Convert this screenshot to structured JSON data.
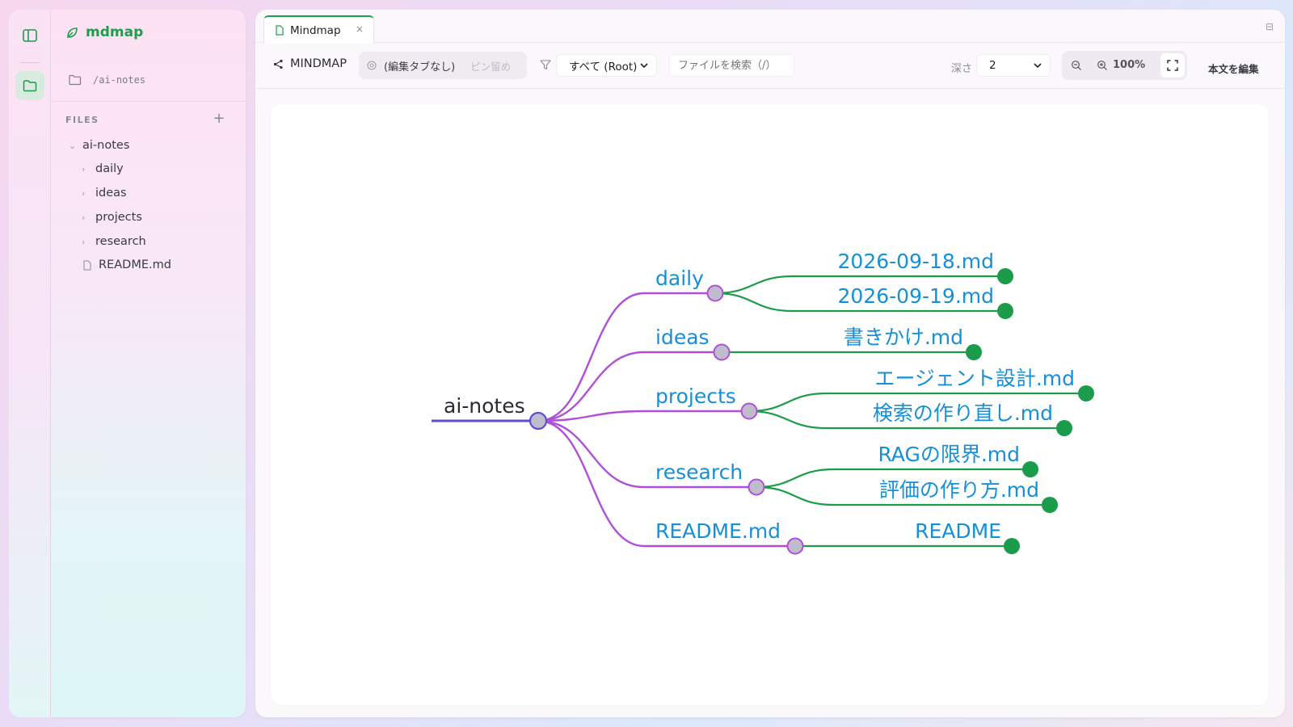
{
  "app": {
    "name": "mdmap",
    "brand_color": "#17a14a"
  },
  "rail": {
    "items": [
      {
        "icon": "sidebar-toggle-icon"
      },
      {
        "icon": "folder-icon",
        "active": true
      }
    ]
  },
  "sidebar": {
    "path": "/ai-notes",
    "files_heading": "FILES",
    "add_label": "+",
    "tree": [
      {
        "label": "ai-notes",
        "type": "folder",
        "expanded": true
      },
      {
        "label": "daily",
        "type": "folder"
      },
      {
        "label": "ideas",
        "type": "folder"
      },
      {
        "label": "projects",
        "type": "folder"
      },
      {
        "label": "research",
        "type": "folder"
      },
      {
        "label": "README.md",
        "type": "file"
      }
    ]
  },
  "tabs": [
    {
      "label": "Mindmap",
      "close": "×"
    }
  ],
  "toolbar": {
    "mindmap_label": "MINDMAP",
    "edit_tab_label": "(編集タブなし)",
    "pin_label": "ピン留め",
    "scope_value": "すべて (Root)",
    "search_placeholder": "ファイルを検索（/）",
    "depth_label": "深さ",
    "depth_value": "2",
    "zoom_percent": "100%",
    "edit_body_label": "本文を編集"
  },
  "mindmap": {
    "root": "ai-notes",
    "colors": {
      "root_line": "#5b4fd6",
      "branch": "#b04fd8",
      "leaf": "#1a9c4a",
      "label": "#1590d8",
      "node_fill": "#bfbccb"
    },
    "branches": [
      {
        "label": "daily",
        "children": [
          "2026-09-18.md",
          "2026-09-19.md"
        ]
      },
      {
        "label": "ideas",
        "children": [
          "書きかけ.md"
        ]
      },
      {
        "label": "projects",
        "children": [
          "エージェント設計.md",
          "検索の作り直し.md"
        ]
      },
      {
        "label": "research",
        "children": [
          "RAGの限界.md",
          "評価の作り方.md"
        ]
      },
      {
        "label": "README.md",
        "children": [
          "README"
        ]
      }
    ]
  }
}
